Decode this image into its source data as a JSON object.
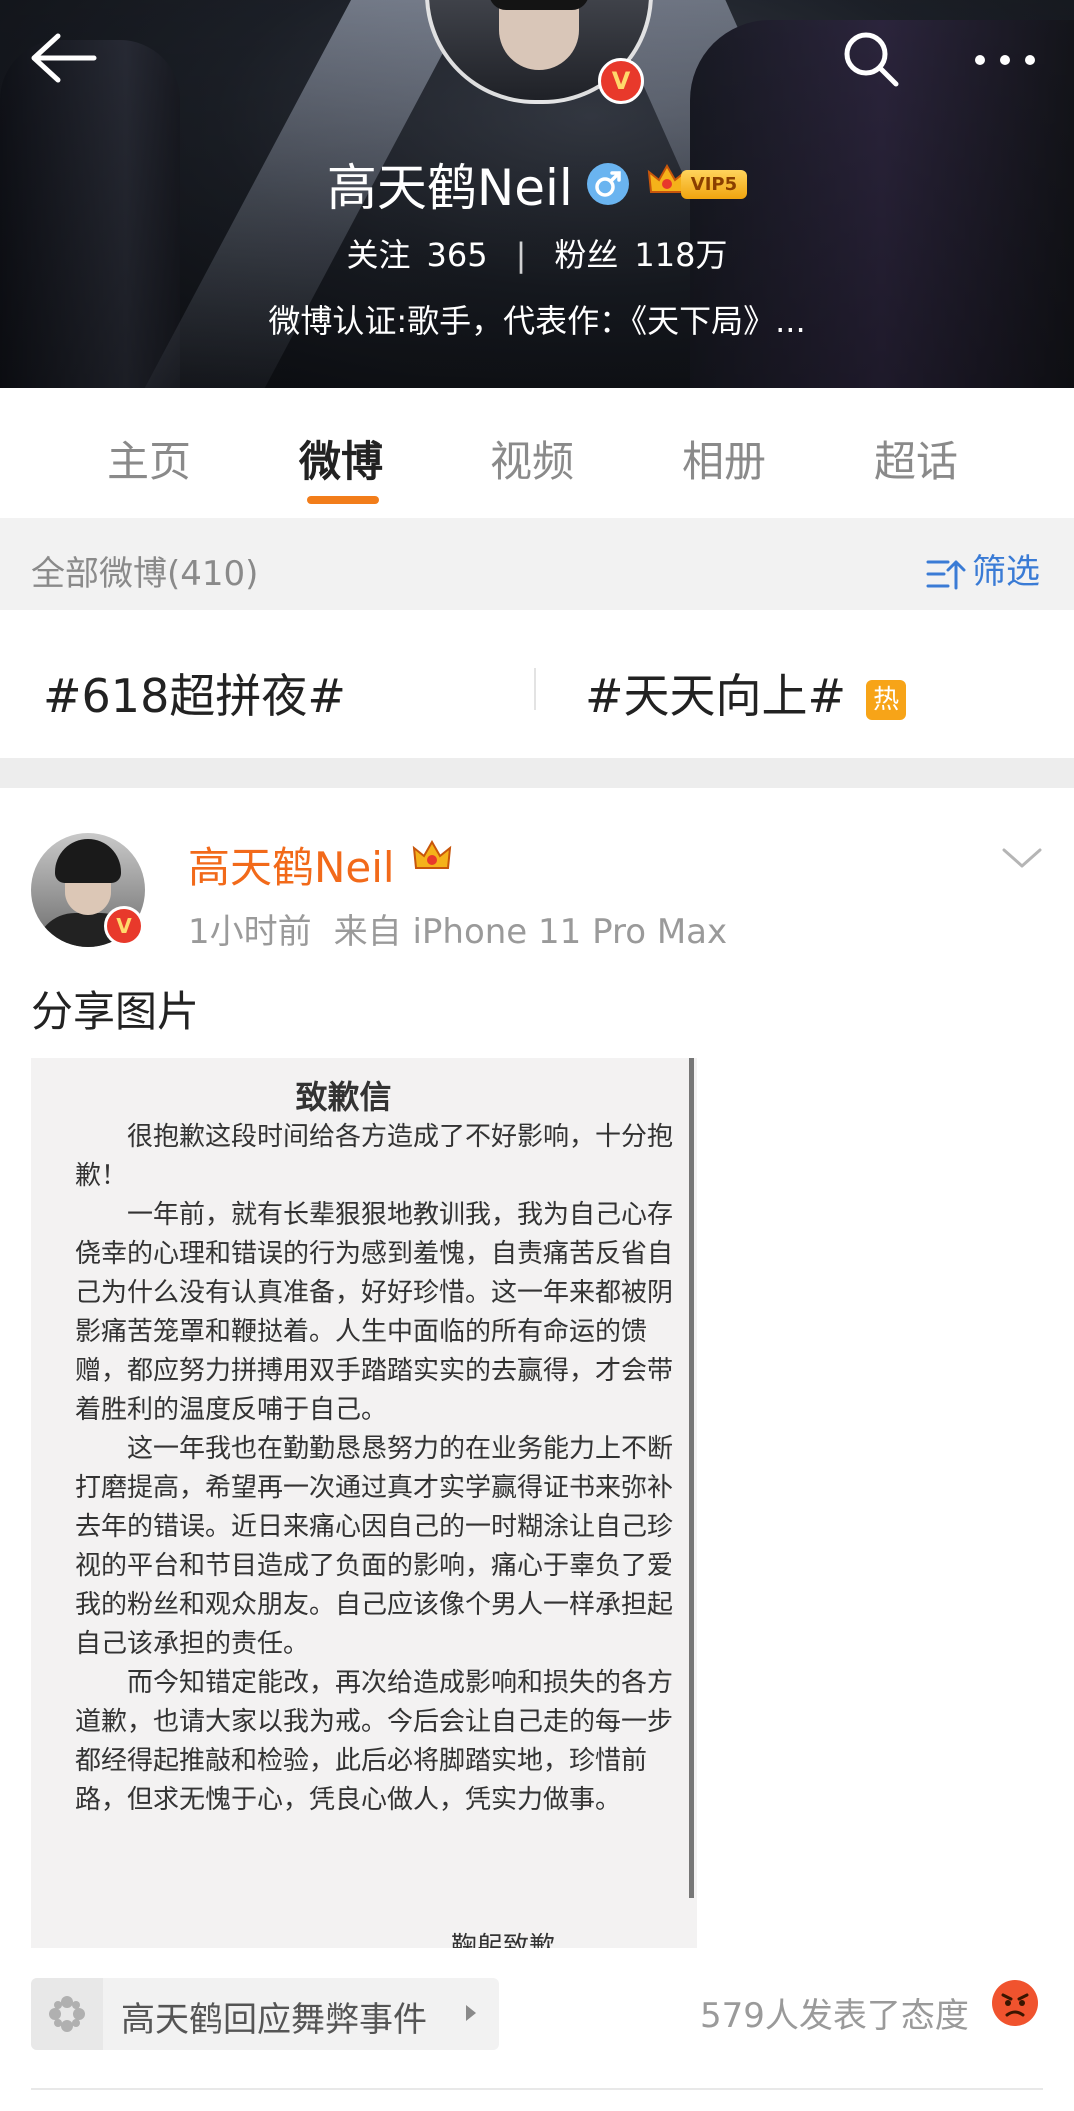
{
  "header": {
    "name": "高天鹤Neil",
    "vip_label": "VIP5",
    "following_label": "关注",
    "following_count": "365",
    "followers_label": "粉丝",
    "followers_count": "118万",
    "separator": "|",
    "verification": "微博认证:歌手，代表作：《天下局》...",
    "badge_letter": "V"
  },
  "tabs": [
    {
      "label": "主页"
    },
    {
      "label": "微博"
    },
    {
      "label": "视频"
    },
    {
      "label": "相册"
    },
    {
      "label": "超话"
    }
  ],
  "active_tab": "微博",
  "filter": {
    "count_label": "全部微博(410)",
    "filter_label": "筛选"
  },
  "topics": [
    {
      "label": "#618超拼夜#"
    },
    {
      "label": "#天天向上#",
      "hot_label": "热"
    }
  ],
  "post": {
    "author": "高天鹤Neil",
    "time": "1小时前",
    "source": "来自 iPhone 11 Pro Max",
    "text": "分享图片",
    "image": {
      "title": "致歉信",
      "paragraphs": [
        "很抱歉这段时间给各方造成了不好影响，十分抱歉！",
        "一年前，就有长辈狠狠地教训我，我为自己心存侥幸的心理和错误的行为感到羞愧，自责痛苦反省自己为什么没有认真准备，好好珍惜。这一年来都被阴影痛苦笼罩和鞭挞着。人生中面临的所有命运的馈赠，都应努力拼搏用双手踏踏实实的去赢得，才会带着胜利的温度反哺于自己。",
        "这一年我也在勤勤恳恳努力的在业务能力上不断打磨提高，希望再一次通过真才实学赢得证书来弥补去年的错误。近日来痛心因自己的一时糊涂让自己珍视的平台和节目造成了负面的影响，痛心于辜负了爱我的粉丝和观众朋友。自己应该像个男人一样承担起自己该承担的责任。",
        "而今知错定能改，再次给造成影响和损失的各方道歉，也请大家以我为戒。今后会让自己走的每一步都经得起推敲和检验，此后必将脚踏实地，珍惜前路，但求无愧于心，凭良心做人，凭实力做事。"
      ],
      "signature": "鞠躬致歉"
    },
    "tag_label": "高天鹤回应舞弊事件",
    "reactions": "579人发表了态度"
  },
  "colors": {
    "accent": "#f27d1a",
    "author": "#f26a1a",
    "link": "#3a7bd5",
    "hot": "#f7a418"
  }
}
